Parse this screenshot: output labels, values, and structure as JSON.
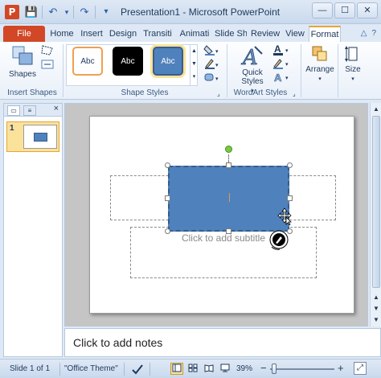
{
  "window": {
    "title": "Presentation1 - Microsoft PowerPoint",
    "app_icon_letter": "P",
    "controls": {
      "minimize": "—",
      "maximize": "☐",
      "close": "✕"
    }
  },
  "qat": {
    "save_icon": "💾",
    "undo_icon": "↶",
    "undo_drop": "▾",
    "redo_icon": "↷",
    "customize_icon": "▾"
  },
  "tabs": [
    {
      "label": "File"
    },
    {
      "label": "Home"
    },
    {
      "label": "Insert"
    },
    {
      "label": "Design"
    },
    {
      "label": "Transiti"
    },
    {
      "label": "Animati"
    },
    {
      "label": "Slide Sh"
    },
    {
      "label": "Review"
    },
    {
      "label": "View"
    },
    {
      "label": "Format"
    }
  ],
  "tabs_right": {
    "minimize_ribbon": "△",
    "help": "?"
  },
  "ribbon": {
    "insert_shapes": {
      "shapes_label": "Shapes",
      "group_label": "Insert Shapes"
    },
    "shape_styles": {
      "styles": [
        "Abc",
        "Abc",
        "Abc"
      ],
      "group_label": "Shape Styles"
    },
    "wordart_styles": {
      "quick_styles_label": "Quick Styles",
      "quick_styles_drop": "▾",
      "group_label": "WordArt Styles"
    },
    "arrange": {
      "label": "Arrange",
      "drop": "▾"
    },
    "size": {
      "label": "Size",
      "drop": "▾"
    },
    "colors": {
      "accent": "#4f81bd",
      "accent_border": "#385d8a",
      "file_tab": "#d24726",
      "highlight": "#e5a537"
    }
  },
  "slides_panel": {
    "tab_slides": "▭",
    "tab_outline": "≡",
    "close": "×",
    "thumbnails": [
      {
        "number": "1"
      }
    ]
  },
  "slide": {
    "subtitle_placeholder": "Click to add subtitle"
  },
  "notes": {
    "placeholder": "Click to add notes"
  },
  "status": {
    "slide_of": "Slide 1 of 1",
    "theme": "\"Office Theme\"",
    "zoom": "39%",
    "zoom_minus": "−",
    "zoom_plus": "+",
    "fit_icon": "⤢"
  }
}
